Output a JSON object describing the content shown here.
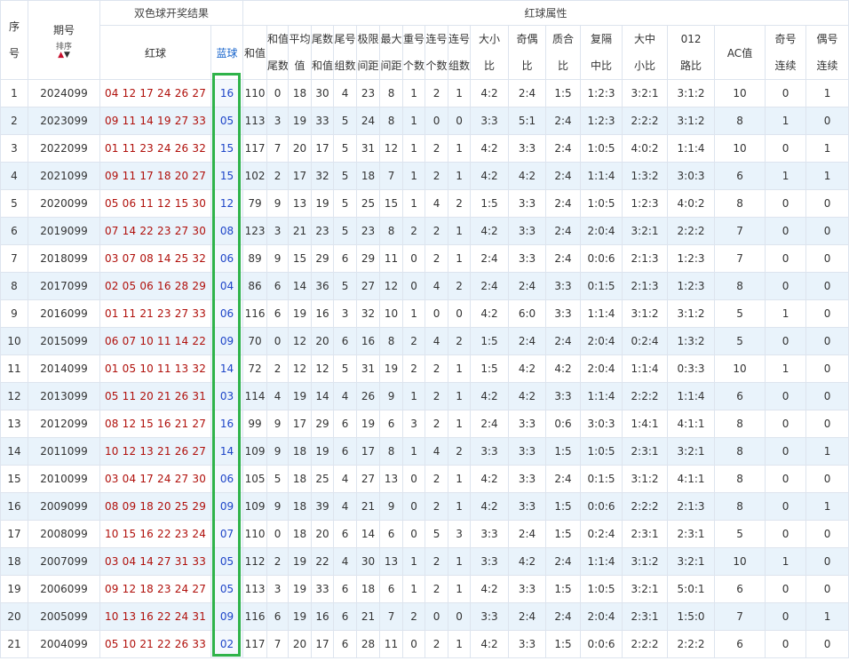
{
  "headers": {
    "xuhao": "序号",
    "qihao": "期号",
    "sort_label": "排序",
    "sort_up": "▲",
    "sort_down": "▼",
    "group_result": "双色球开奖结果",
    "group_attr": "红球属性",
    "red_ball": "红球",
    "blue_ball": "蓝球",
    "hezhi": "和值",
    "hezhi_weishu": "和值尾数",
    "pingjunzhi": "平均值",
    "weishu_hezhi": "尾数和值",
    "weihao_zushu": "尾号组数",
    "jixian_jianju": "极限间距",
    "zuida_jianju": "最大间距",
    "chonghao_geshu": "重号个数",
    "lianhao_geshu": "连号个数",
    "lianhao_zushu": "连号组数",
    "daxiao_bi": "大小比",
    "jiou_bi": "奇偶比",
    "zhihe_bi": "质合比",
    "fuge_zhongbi": "复隔中比",
    "dazhong_xiaobi": "大中小比",
    "lubi_012": "012路比",
    "ac": "AC值",
    "jihao_lianxu": "奇号连续",
    "ouhao_lianxu": "偶号连续"
  },
  "rows": [
    {
      "no": "1",
      "issue": "2024099",
      "red": "04 12 17 24 26 27",
      "blue": "16",
      "sum": "110",
      "sumTail": "0",
      "avg": "18",
      "tailSum": "30",
      "tailGroups": "4",
      "range": "23",
      "maxGap": "8",
      "repeat": "1",
      "consec": "2",
      "consecGroups": "1",
      "bigSmall": "4:2",
      "oddEven": "2:4",
      "primeComp": "1:5",
      "fgz": "1:2:3",
      "dzx": "3:2:1",
      "r012": "3:1:2",
      "ac": "10",
      "oddCons": "0",
      "evenCons": "1"
    },
    {
      "no": "2",
      "issue": "2023099",
      "red": "09 11 14 19 27 33",
      "blue": "05",
      "sum": "113",
      "sumTail": "3",
      "avg": "19",
      "tailSum": "33",
      "tailGroups": "5",
      "range": "24",
      "maxGap": "8",
      "repeat": "1",
      "consec": "0",
      "consecGroups": "0",
      "bigSmall": "3:3",
      "oddEven": "5:1",
      "primeComp": "2:4",
      "fgz": "1:2:3",
      "dzx": "2:2:2",
      "r012": "3:1:2",
      "ac": "8",
      "oddCons": "1",
      "evenCons": "0"
    },
    {
      "no": "3",
      "issue": "2022099",
      "red": "01 11 23 24 26 32",
      "blue": "15",
      "sum": "117",
      "sumTail": "7",
      "avg": "20",
      "tailSum": "17",
      "tailGroups": "5",
      "range": "31",
      "maxGap": "12",
      "repeat": "1",
      "consec": "2",
      "consecGroups": "1",
      "bigSmall": "4:2",
      "oddEven": "3:3",
      "primeComp": "2:4",
      "fgz": "1:0:5",
      "dzx": "4:0:2",
      "r012": "1:1:4",
      "ac": "10",
      "oddCons": "0",
      "evenCons": "1"
    },
    {
      "no": "4",
      "issue": "2021099",
      "red": "09 11 17 18 20 27",
      "blue": "15",
      "sum": "102",
      "sumTail": "2",
      "avg": "17",
      "tailSum": "32",
      "tailGroups": "5",
      "range": "18",
      "maxGap": "7",
      "repeat": "1",
      "consec": "2",
      "consecGroups": "1",
      "bigSmall": "4:2",
      "oddEven": "4:2",
      "primeComp": "2:4",
      "fgz": "1:1:4",
      "dzx": "1:3:2",
      "r012": "3:0:3",
      "ac": "6",
      "oddCons": "1",
      "evenCons": "1"
    },
    {
      "no": "5",
      "issue": "2020099",
      "red": "05 06 11 12 15 30",
      "blue": "12",
      "sum": "79",
      "sumTail": "9",
      "avg": "13",
      "tailSum": "19",
      "tailGroups": "5",
      "range": "25",
      "maxGap": "15",
      "repeat": "1",
      "consec": "4",
      "consecGroups": "2",
      "bigSmall": "1:5",
      "oddEven": "3:3",
      "primeComp": "2:4",
      "fgz": "1:0:5",
      "dzx": "1:2:3",
      "r012": "4:0:2",
      "ac": "8",
      "oddCons": "0",
      "evenCons": "0"
    },
    {
      "no": "6",
      "issue": "2019099",
      "red": "07 14 22 23 27 30",
      "blue": "08",
      "sum": "123",
      "sumTail": "3",
      "avg": "21",
      "tailSum": "23",
      "tailGroups": "5",
      "range": "23",
      "maxGap": "8",
      "repeat": "2",
      "consec": "2",
      "consecGroups": "1",
      "bigSmall": "4:2",
      "oddEven": "3:3",
      "primeComp": "2:4",
      "fgz": "2:0:4",
      "dzx": "3:2:1",
      "r012": "2:2:2",
      "ac": "7",
      "oddCons": "0",
      "evenCons": "0"
    },
    {
      "no": "7",
      "issue": "2018099",
      "red": "03 07 08 14 25 32",
      "blue": "06",
      "sum": "89",
      "sumTail": "9",
      "avg": "15",
      "tailSum": "29",
      "tailGroups": "6",
      "range": "29",
      "maxGap": "11",
      "repeat": "0",
      "consec": "2",
      "consecGroups": "1",
      "bigSmall": "2:4",
      "oddEven": "3:3",
      "primeComp": "2:4",
      "fgz": "0:0:6",
      "dzx": "2:1:3",
      "r012": "1:2:3",
      "ac": "7",
      "oddCons": "0",
      "evenCons": "0"
    },
    {
      "no": "8",
      "issue": "2017099",
      "red": "02 05 06 16 28 29",
      "blue": "04",
      "sum": "86",
      "sumTail": "6",
      "avg": "14",
      "tailSum": "36",
      "tailGroups": "5",
      "range": "27",
      "maxGap": "12",
      "repeat": "0",
      "consec": "4",
      "consecGroups": "2",
      "bigSmall": "2:4",
      "oddEven": "2:4",
      "primeComp": "3:3",
      "fgz": "0:1:5",
      "dzx": "2:1:3",
      "r012": "1:2:3",
      "ac": "8",
      "oddCons": "0",
      "evenCons": "0"
    },
    {
      "no": "9",
      "issue": "2016099",
      "red": "01 11 21 23 27 33",
      "blue": "06",
      "sum": "116",
      "sumTail": "6",
      "avg": "19",
      "tailSum": "16",
      "tailGroups": "3",
      "range": "32",
      "maxGap": "10",
      "repeat": "1",
      "consec": "0",
      "consecGroups": "0",
      "bigSmall": "4:2",
      "oddEven": "6:0",
      "primeComp": "3:3",
      "fgz": "1:1:4",
      "dzx": "3:1:2",
      "r012": "3:1:2",
      "ac": "5",
      "oddCons": "1",
      "evenCons": "0"
    },
    {
      "no": "10",
      "issue": "2015099",
      "red": "06 07 10 11 14 22",
      "blue": "09",
      "sum": "70",
      "sumTail": "0",
      "avg": "12",
      "tailSum": "20",
      "tailGroups": "6",
      "range": "16",
      "maxGap": "8",
      "repeat": "2",
      "consec": "4",
      "consecGroups": "2",
      "bigSmall": "1:5",
      "oddEven": "2:4",
      "primeComp": "2:4",
      "fgz": "2:0:4",
      "dzx": "0:2:4",
      "r012": "1:3:2",
      "ac": "5",
      "oddCons": "0",
      "evenCons": "0"
    },
    {
      "no": "11",
      "issue": "2014099",
      "red": "01 05 10 11 13 32",
      "blue": "14",
      "sum": "72",
      "sumTail": "2",
      "avg": "12",
      "tailSum": "12",
      "tailGroups": "5",
      "range": "31",
      "maxGap": "19",
      "repeat": "2",
      "consec": "2",
      "consecGroups": "1",
      "bigSmall": "1:5",
      "oddEven": "4:2",
      "primeComp": "4:2",
      "fgz": "2:0:4",
      "dzx": "1:1:4",
      "r012": "0:3:3",
      "ac": "10",
      "oddCons": "1",
      "evenCons": "0"
    },
    {
      "no": "12",
      "issue": "2013099",
      "red": "05 11 20 21 26 31",
      "blue": "03",
      "sum": "114",
      "sumTail": "4",
      "avg": "19",
      "tailSum": "14",
      "tailGroups": "4",
      "range": "26",
      "maxGap": "9",
      "repeat": "1",
      "consec": "2",
      "consecGroups": "1",
      "bigSmall": "4:2",
      "oddEven": "4:2",
      "primeComp": "3:3",
      "fgz": "1:1:4",
      "dzx": "2:2:2",
      "r012": "1:1:4",
      "ac": "6",
      "oddCons": "0",
      "evenCons": "0"
    },
    {
      "no": "13",
      "issue": "2012099",
      "red": "08 12 15 16 21 27",
      "blue": "16",
      "sum": "99",
      "sumTail": "9",
      "avg": "17",
      "tailSum": "29",
      "tailGroups": "6",
      "range": "19",
      "maxGap": "6",
      "repeat": "3",
      "consec": "2",
      "consecGroups": "1",
      "bigSmall": "2:4",
      "oddEven": "3:3",
      "primeComp": "0:6",
      "fgz": "3:0:3",
      "dzx": "1:4:1",
      "r012": "4:1:1",
      "ac": "8",
      "oddCons": "0",
      "evenCons": "0"
    },
    {
      "no": "14",
      "issue": "2011099",
      "red": "10 12 13 21 26 27",
      "blue": "14",
      "sum": "109",
      "sumTail": "9",
      "avg": "18",
      "tailSum": "19",
      "tailGroups": "6",
      "range": "17",
      "maxGap": "8",
      "repeat": "1",
      "consec": "4",
      "consecGroups": "2",
      "bigSmall": "3:3",
      "oddEven": "3:3",
      "primeComp": "1:5",
      "fgz": "1:0:5",
      "dzx": "2:3:1",
      "r012": "3:2:1",
      "ac": "8",
      "oddCons": "0",
      "evenCons": "1"
    },
    {
      "no": "15",
      "issue": "2010099",
      "red": "03 04 17 24 27 30",
      "blue": "06",
      "sum": "105",
      "sumTail": "5",
      "avg": "18",
      "tailSum": "25",
      "tailGroups": "4",
      "range": "27",
      "maxGap": "13",
      "repeat": "0",
      "consec": "2",
      "consecGroups": "1",
      "bigSmall": "4:2",
      "oddEven": "3:3",
      "primeComp": "2:4",
      "fgz": "0:1:5",
      "dzx": "3:1:2",
      "r012": "4:1:1",
      "ac": "8",
      "oddCons": "0",
      "evenCons": "0"
    },
    {
      "no": "16",
      "issue": "2009099",
      "red": "08 09 18 20 25 29",
      "blue": "09",
      "sum": "109",
      "sumTail": "9",
      "avg": "18",
      "tailSum": "39",
      "tailGroups": "4",
      "range": "21",
      "maxGap": "9",
      "repeat": "0",
      "consec": "2",
      "consecGroups": "1",
      "bigSmall": "4:2",
      "oddEven": "3:3",
      "primeComp": "1:5",
      "fgz": "0:0:6",
      "dzx": "2:2:2",
      "r012": "2:1:3",
      "ac": "8",
      "oddCons": "0",
      "evenCons": "1"
    },
    {
      "no": "17",
      "issue": "2008099",
      "red": "10 15 16 22 23 24",
      "blue": "07",
      "sum": "110",
      "sumTail": "0",
      "avg": "18",
      "tailSum": "20",
      "tailGroups": "6",
      "range": "14",
      "maxGap": "6",
      "repeat": "0",
      "consec": "5",
      "consecGroups": "3",
      "bigSmall": "3:3",
      "oddEven": "2:4",
      "primeComp": "1:5",
      "fgz": "0:2:4",
      "dzx": "2:3:1",
      "r012": "2:3:1",
      "ac": "5",
      "oddCons": "0",
      "evenCons": "0"
    },
    {
      "no": "18",
      "issue": "2007099",
      "red": "03 04 14 27 31 33",
      "blue": "05",
      "sum": "112",
      "sumTail": "2",
      "avg": "19",
      "tailSum": "22",
      "tailGroups": "4",
      "range": "30",
      "maxGap": "13",
      "repeat": "1",
      "consec": "2",
      "consecGroups": "1",
      "bigSmall": "3:3",
      "oddEven": "4:2",
      "primeComp": "2:4",
      "fgz": "1:1:4",
      "dzx": "3:1:2",
      "r012": "3:2:1",
      "ac": "10",
      "oddCons": "1",
      "evenCons": "0"
    },
    {
      "no": "19",
      "issue": "2006099",
      "red": "09 12 18 23 24 27",
      "blue": "05",
      "sum": "113",
      "sumTail": "3",
      "avg": "19",
      "tailSum": "33",
      "tailGroups": "6",
      "range": "18",
      "maxGap": "6",
      "repeat": "1",
      "consec": "2",
      "consecGroups": "1",
      "bigSmall": "4:2",
      "oddEven": "3:3",
      "primeComp": "1:5",
      "fgz": "1:0:5",
      "dzx": "3:2:1",
      "r012": "5:0:1",
      "ac": "6",
      "oddCons": "0",
      "evenCons": "0"
    },
    {
      "no": "20",
      "issue": "2005099",
      "red": "10 13 16 22 24 31",
      "blue": "09",
      "sum": "116",
      "sumTail": "6",
      "avg": "19",
      "tailSum": "16",
      "tailGroups": "6",
      "range": "21",
      "maxGap": "7",
      "repeat": "2",
      "consec": "0",
      "consecGroups": "0",
      "bigSmall": "3:3",
      "oddEven": "2:4",
      "primeComp": "2:4",
      "fgz": "2:0:4",
      "dzx": "2:3:1",
      "r012": "1:5:0",
      "ac": "7",
      "oddCons": "0",
      "evenCons": "1"
    },
    {
      "no": "21",
      "issue": "2004099",
      "red": "05 10 21 22 26 33",
      "blue": "02",
      "sum": "117",
      "sumTail": "7",
      "avg": "20",
      "tailSum": "17",
      "tailGroups": "6",
      "range": "28",
      "maxGap": "11",
      "repeat": "0",
      "consec": "2",
      "consecGroups": "1",
      "bigSmall": "4:2",
      "oddEven": "3:3",
      "primeComp": "1:5",
      "fgz": "0:0:6",
      "dzx": "2:2:2",
      "r012": "2:2:2",
      "ac": "6",
      "oddCons": "0",
      "evenCons": "0"
    }
  ],
  "highlight_color": "#2fb34a",
  "red_color": "#b0100b",
  "blue_color": "#1e45c8"
}
